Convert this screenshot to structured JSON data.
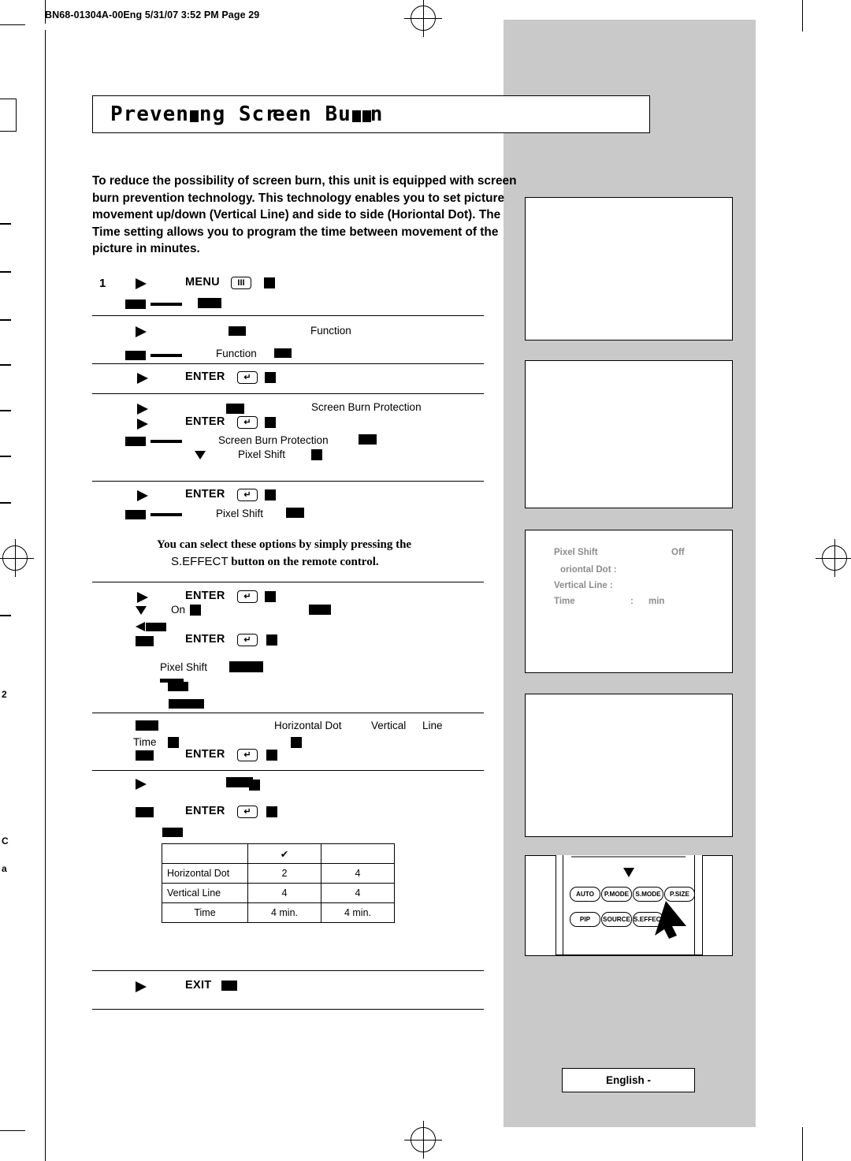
{
  "header": {
    "file_line": "BN68-01304A-00Eng  5/31/07  3:52 PM  Page  29"
  },
  "title": {
    "text_before": "Preven",
    "text_mid": "ng  Scr",
    "text_mid2": "een  Bu",
    "text_after": "n",
    "full": "Preventing Screen Burn-In"
  },
  "intro": {
    "paragraph": "To reduce the possibility of screen burn, this unit is equipped with screen burn prevention technology. This technology enables you to set picture movement up/down (Vertical Line) and side to side (Horiontal Dot). The Time setting allows you to program the time between movement of the picture in minutes."
  },
  "steps": [
    {
      "num": "1",
      "label": "MENU",
      "key": "III",
      "text": ""
    },
    {
      "num": "",
      "label": "",
      "text": "Function"
    },
    {
      "num": "",
      "label": "",
      "text": "Function"
    },
    {
      "num": "",
      "label": "ENTER",
      "key": "↵",
      "text": ""
    },
    {
      "num": "",
      "label": "",
      "text": "Screen Burn Protection"
    },
    {
      "num": "",
      "label": "ENTER",
      "key": "↵",
      "text": ""
    },
    {
      "num": "",
      "label": "",
      "text": "Screen Burn Protection"
    },
    {
      "num": "",
      "label": "",
      "text": "Pixel Shift"
    },
    {
      "num": "",
      "label": "ENTER",
      "key": "↵",
      "text": ""
    },
    {
      "num": "",
      "label": "",
      "text": "Pixel Shift"
    },
    {
      "num": "",
      "label": "ENTER",
      "key": "↵",
      "text": ""
    },
    {
      "num": "",
      "label": "",
      "text": "On"
    },
    {
      "num": "",
      "label": "ENTER",
      "key": "↵",
      "text": ""
    },
    {
      "num": "",
      "label": "",
      "text": "Pixel Shift"
    },
    {
      "num": "",
      "label": "",
      "text": "Horizontal Dot"
    },
    {
      "num": "",
      "label": "",
      "text": "Vertical"
    },
    {
      "num": "",
      "label": "",
      "text": "Line"
    },
    {
      "num": "",
      "label": "",
      "text": "Time"
    },
    {
      "num": "",
      "label": "ENTER",
      "key": "↵",
      "text": ""
    },
    {
      "num": "",
      "label": "ENTER",
      "key": "↵",
      "text": ""
    },
    {
      "num": "",
      "label": "EXIT",
      "key": "",
      "text": ""
    }
  ],
  "note": {
    "line1": "You can select these options by simply pressing the",
    "line2_a": "S.EFFECT",
    "line2_b": "button on the remote control."
  },
  "table": {
    "check": "✔",
    "rows": [
      {
        "label": "Horizontal Dot",
        "v1": "2",
        "v2": "4"
      },
      {
        "label": "Vertical Line",
        "v1": "4",
        "v2": "4"
      },
      {
        "label": "Time",
        "v1": "4 min.",
        "v2": "4 min."
      }
    ]
  },
  "osd": {
    "title": "Pixel Shift",
    "title_value": "Off",
    "rows": [
      {
        "label": "oriontal Dot :",
        "value": ""
      },
      {
        "label": "Vertical Line  :",
        "value": ""
      },
      {
        "label": "Time",
        "sep": ":",
        "value": "min"
      }
    ]
  },
  "remote": {
    "buttons_row1": [
      "AUTO",
      "P.MODE",
      "S.MODE",
      "P.SIZE"
    ],
    "buttons_row2": [
      "PIP",
      "SOURCE",
      "S.EFFECT"
    ]
  },
  "footer": {
    "badge": "English -"
  },
  "margin": {
    "num": "2",
    "letter_c": "C",
    "letter_a": "a"
  }
}
